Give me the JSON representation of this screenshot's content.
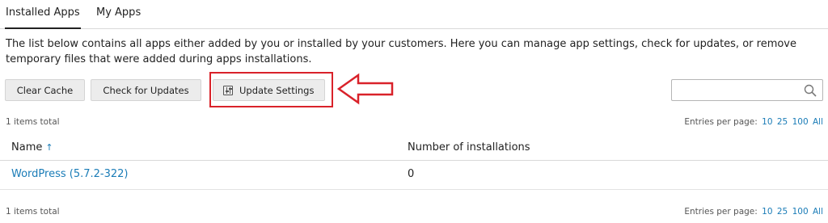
{
  "tabs": [
    {
      "label": "Installed Apps",
      "active": true
    },
    {
      "label": "My Apps",
      "active": false
    }
  ],
  "description": "The list below contains all apps either added by you or installed by your customers. Here you can manage app settings, check for updates, or remove temporary files that were added during apps installations.",
  "toolbar": {
    "clear_cache": "Clear Cache",
    "check_updates": "Check for Updates",
    "update_settings": "Update Settings"
  },
  "search": {
    "placeholder": "",
    "value": ""
  },
  "pagination": {
    "total_label": "1 items total",
    "entries_label": "Entries per page:",
    "options": [
      "10",
      "25",
      "100",
      "All"
    ]
  },
  "table": {
    "columns": [
      "Name",
      "Number of installations"
    ],
    "sort_indicator": "↑",
    "rows": [
      {
        "name": "WordPress (5.7.2-322)",
        "installations": "0"
      }
    ]
  },
  "colors": {
    "accent": "#1a7cb7",
    "highlight": "#d9222a"
  }
}
